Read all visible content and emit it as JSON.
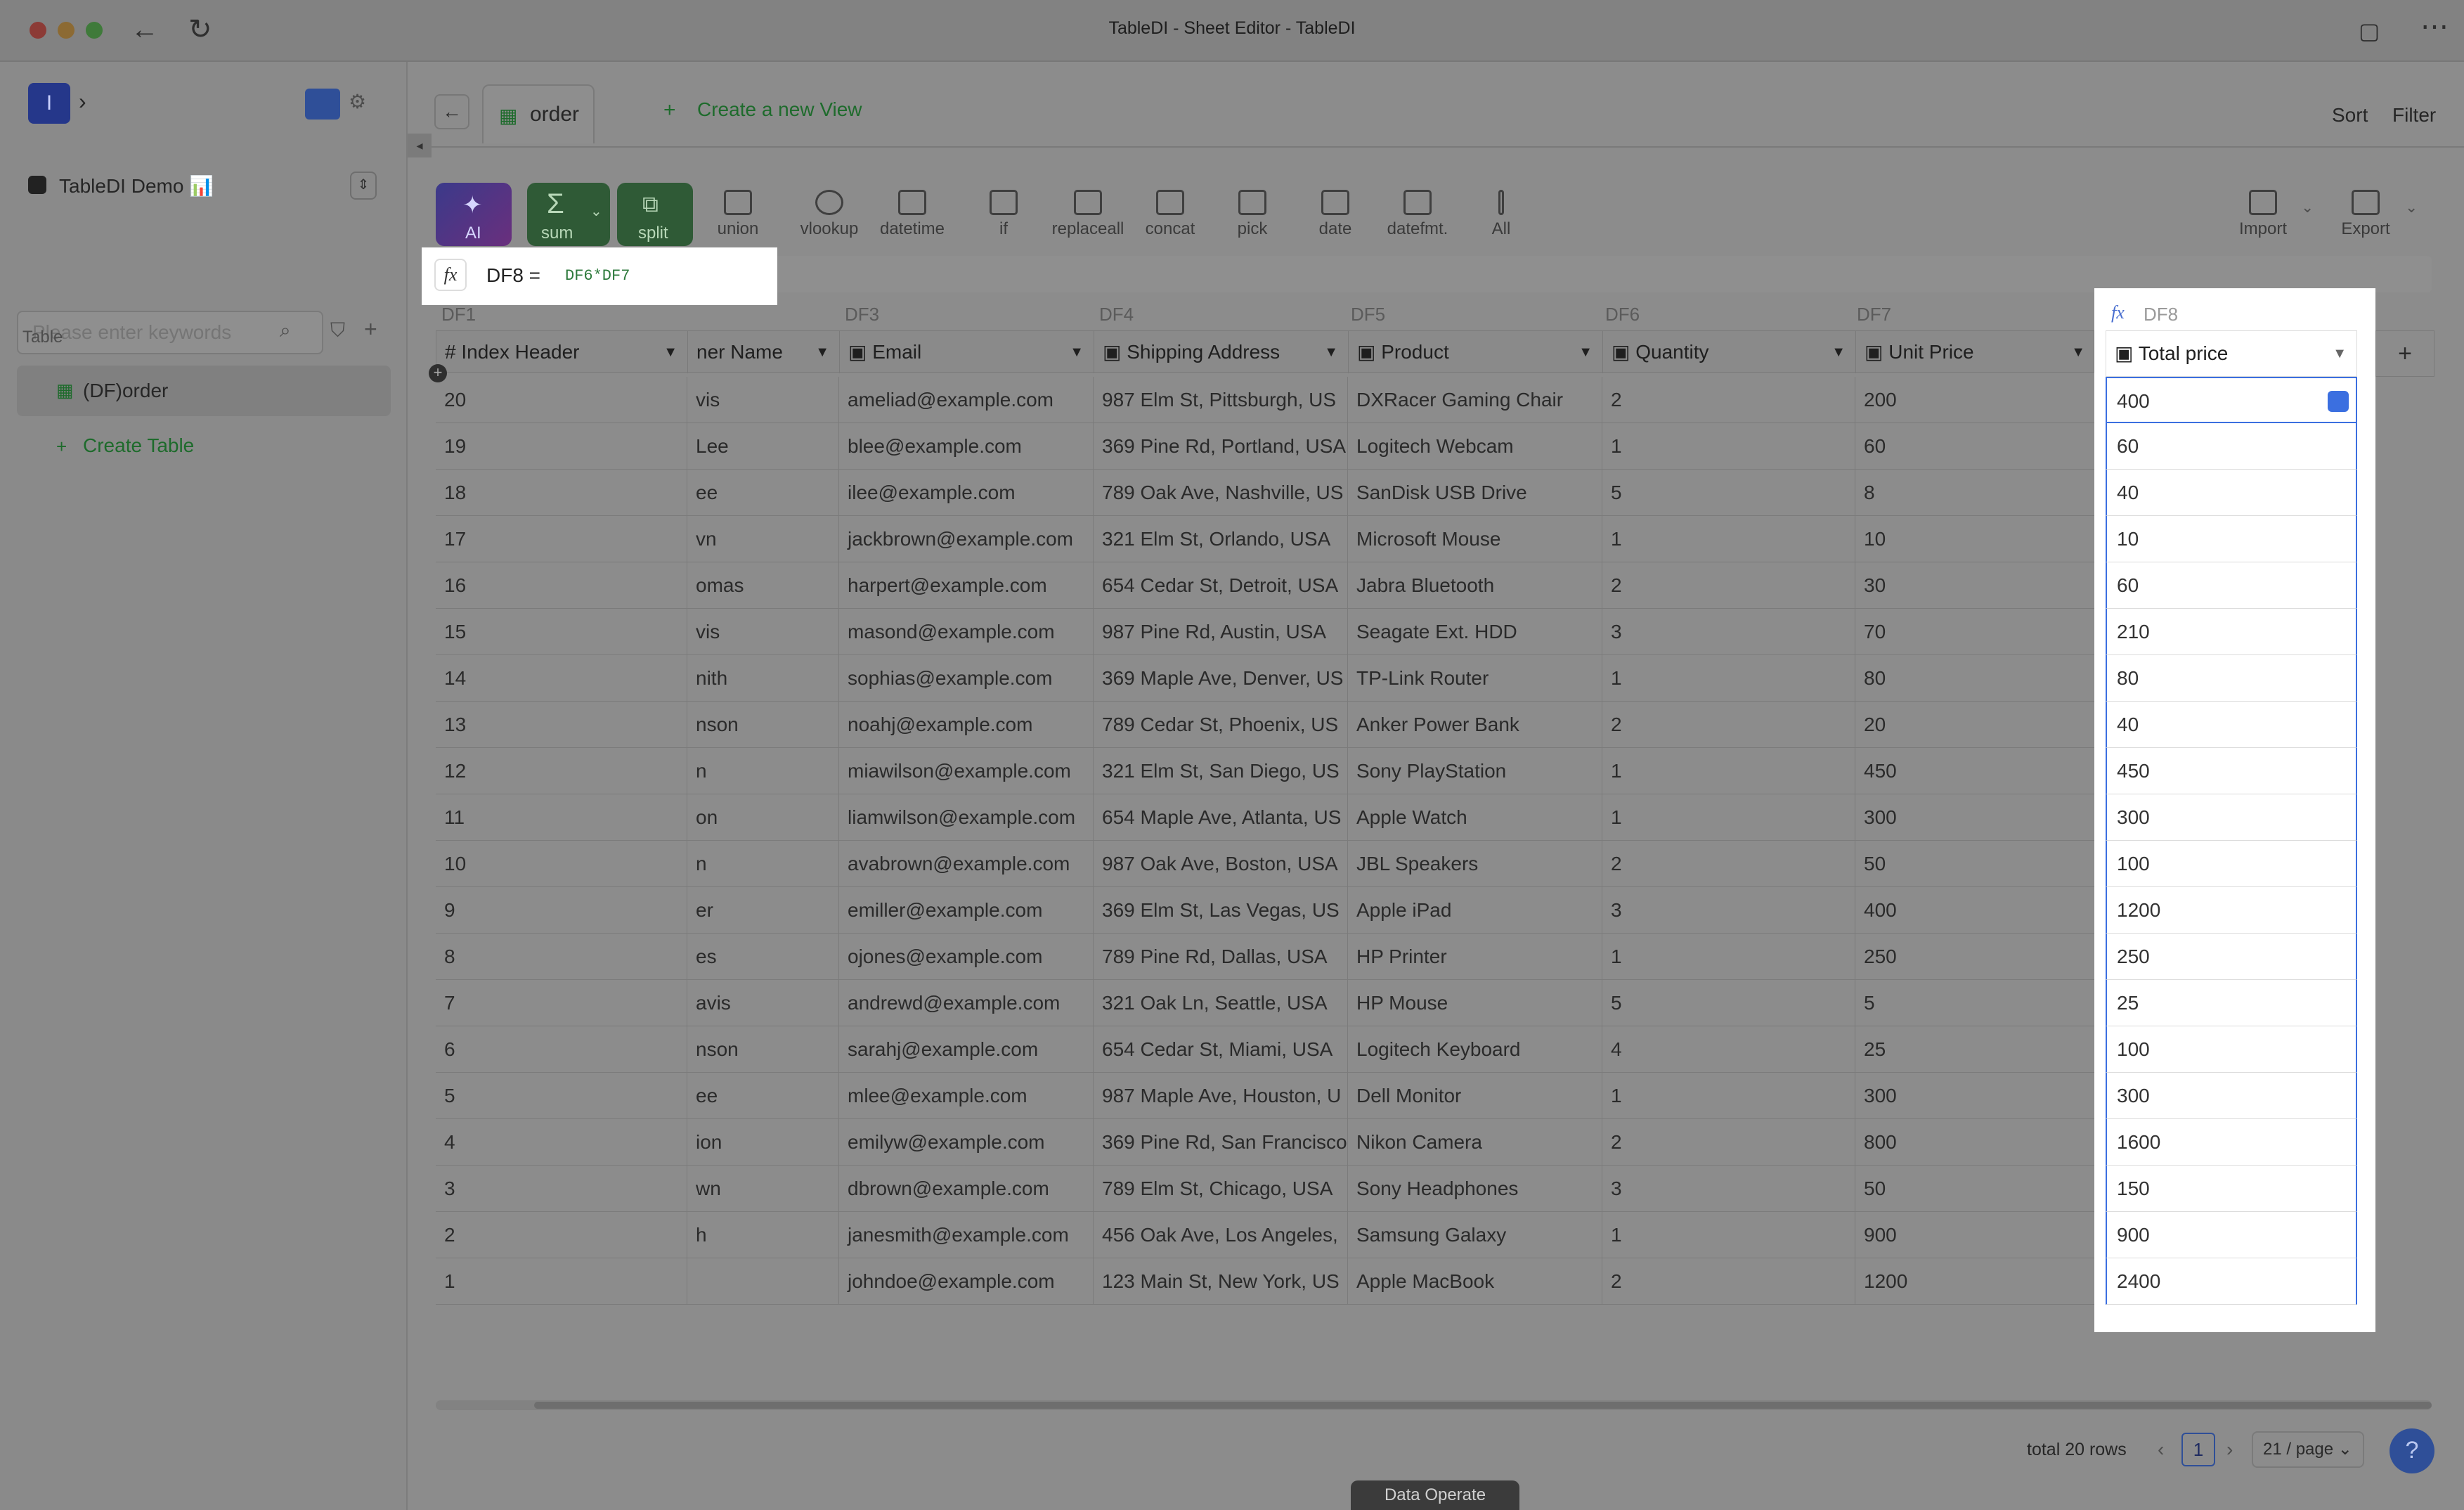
{
  "window": {
    "title": "TableDI - Sheet Editor - TableDI"
  },
  "sidebar": {
    "workspace": "TableDI Demo 📊",
    "search_placeholder": "Please enter keywords",
    "section_label": "Table",
    "table_item": "(DF)order",
    "create_table": "Create Table"
  },
  "tabs": {
    "active": "order",
    "create_view": "Create a new View",
    "sort": "Sort",
    "filter": "Filter"
  },
  "toolbar": {
    "buttons": [
      "AI",
      "sum",
      "split",
      "union",
      "vlookup",
      "datetime",
      "if",
      "replaceall",
      "concat",
      "pick",
      "date",
      "datefmt.",
      "All"
    ],
    "import": "Import",
    "export": "Export"
  },
  "formula": {
    "label": "DF8 =",
    "expr": "DF6*DF7"
  },
  "columns": {
    "df_labels": [
      "DF1",
      "DF3",
      "DF4",
      "DF5",
      "DF6",
      "DF7",
      "DF8"
    ],
    "headers": [
      "Index Header",
      "ner Name",
      "Email",
      "Shipping Address",
      "Product",
      "Quantity",
      "Unit Price",
      "Total price"
    ]
  },
  "rows": [
    [
      "20",
      "vis",
      "ameliad@example.com",
      "987 Elm St, Pittsburgh, US",
      "DXRacer Gaming Chair",
      "2",
      "200",
      "400"
    ],
    [
      "19",
      "Lee",
      "blee@example.com",
      "369 Pine Rd, Portland, USA",
      "Logitech Webcam",
      "1",
      "60",
      "60"
    ],
    [
      "18",
      "ee",
      "ilee@example.com",
      "789 Oak Ave, Nashville, US",
      "SanDisk USB Drive",
      "5",
      "8",
      "40"
    ],
    [
      "17",
      "vn",
      "jackbrown@example.com",
      "321 Elm St, Orlando, USA",
      "Microsoft Mouse",
      "1",
      "10",
      "10"
    ],
    [
      "16",
      "omas",
      "harpert@example.com",
      "654 Cedar St, Detroit, USA",
      "Jabra Bluetooth",
      "2",
      "30",
      "60"
    ],
    [
      "15",
      "vis",
      "masond@example.com",
      "987 Pine Rd, Austin, USA",
      "Seagate Ext. HDD",
      "3",
      "70",
      "210"
    ],
    [
      "14",
      "nith",
      "sophias@example.com",
      "369 Maple Ave, Denver, US",
      "TP-Link Router",
      "1",
      "80",
      "80"
    ],
    [
      "13",
      "nson",
      "noahj@example.com",
      "789 Cedar St, Phoenix, US",
      "Anker Power Bank",
      "2",
      "20",
      "40"
    ],
    [
      "12",
      "n",
      "miawilson@example.com",
      "321 Elm St, San Diego, US",
      "Sony PlayStation",
      "1",
      "450",
      "450"
    ],
    [
      "11",
      "on",
      "liamwilson@example.com",
      "654 Maple Ave, Atlanta, US",
      "Apple Watch",
      "1",
      "300",
      "300"
    ],
    [
      "10",
      "n",
      "avabrown@example.com",
      "987 Oak Ave, Boston, USA",
      "JBL Speakers",
      "2",
      "50",
      "100"
    ],
    [
      "9",
      "er",
      "emiller@example.com",
      "369 Elm St, Las Vegas, US",
      "Apple iPad",
      "3",
      "400",
      "1200"
    ],
    [
      "8",
      "es",
      "ojones@example.com",
      "789 Pine Rd, Dallas, USA",
      "HP Printer",
      "1",
      "250",
      "250"
    ],
    [
      "7",
      "avis",
      "andrewd@example.com",
      "321 Oak Ln, Seattle, USA",
      "HP Mouse",
      "5",
      "5",
      "25"
    ],
    [
      "6",
      "nson",
      "sarahj@example.com",
      "654 Cedar St, Miami, USA",
      "Logitech Keyboard",
      "4",
      "25",
      "100"
    ],
    [
      "5",
      "ee",
      "mlee@example.com",
      "987 Maple Ave, Houston, U",
      "Dell Monitor",
      "1",
      "300",
      "300"
    ],
    [
      "4",
      "ion",
      "emilyw@example.com",
      "369 Pine Rd, San Francisco",
      "Nikon Camera",
      "2",
      "800",
      "1600"
    ],
    [
      "3",
      "wn",
      "dbrown@example.com",
      "789 Elm St, Chicago, USA",
      "Sony Headphones",
      "3",
      "50",
      "150"
    ],
    [
      "2",
      "h",
      "janesmith@example.com",
      "456 Oak Ave, Los Angeles,",
      "Samsung Galaxy",
      "1",
      "900",
      "900"
    ],
    [
      "1",
      "",
      "johndoe@example.com",
      "123 Main St, New York, US",
      "Apple MacBook",
      "2",
      "1200",
      "2400"
    ]
  ],
  "footer": {
    "total": "total 20 rows",
    "page": "1",
    "page_size": "21 / page",
    "data_operate": "Data Operate",
    "help": "?"
  }
}
